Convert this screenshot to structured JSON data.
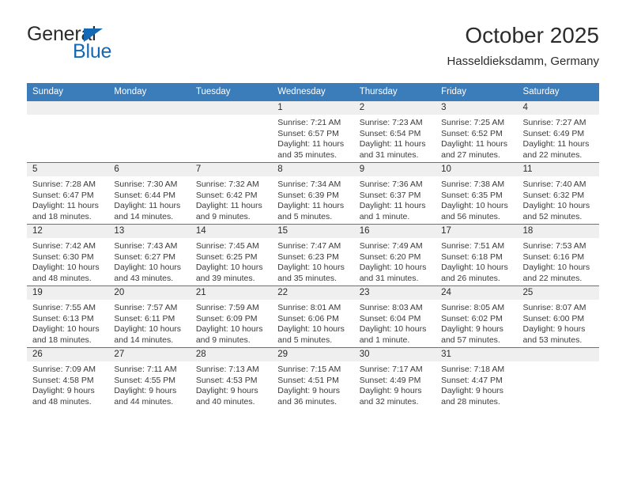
{
  "brand": {
    "name_part1": "General",
    "name_part2": "Blue",
    "colors": {
      "blue": "#1569b4",
      "dark": "#2b2b2b"
    },
    "triangle_icon": "triangle-icon"
  },
  "header": {
    "title": "October 2025",
    "subtitle": "Hasseldieksdamm, Germany"
  },
  "calendar": {
    "header_bg": "#3b7cba",
    "daynum_bg": "#efefef",
    "weekday_headers": [
      "Sunday",
      "Monday",
      "Tuesday",
      "Wednesday",
      "Thursday",
      "Friday",
      "Saturday"
    ],
    "weeks": [
      [
        {
          "day": "",
          "sunrise": "",
          "sunset": "",
          "daylight": ""
        },
        {
          "day": "",
          "sunrise": "",
          "sunset": "",
          "daylight": ""
        },
        {
          "day": "",
          "sunrise": "",
          "sunset": "",
          "daylight": ""
        },
        {
          "day": "1",
          "sunrise": "Sunrise: 7:21 AM",
          "sunset": "Sunset: 6:57 PM",
          "daylight": "Daylight: 11 hours and 35 minutes."
        },
        {
          "day": "2",
          "sunrise": "Sunrise: 7:23 AM",
          "sunset": "Sunset: 6:54 PM",
          "daylight": "Daylight: 11 hours and 31 minutes."
        },
        {
          "day": "3",
          "sunrise": "Sunrise: 7:25 AM",
          "sunset": "Sunset: 6:52 PM",
          "daylight": "Daylight: 11 hours and 27 minutes."
        },
        {
          "day": "4",
          "sunrise": "Sunrise: 7:27 AM",
          "sunset": "Sunset: 6:49 PM",
          "daylight": "Daylight: 11 hours and 22 minutes."
        }
      ],
      [
        {
          "day": "5",
          "sunrise": "Sunrise: 7:28 AM",
          "sunset": "Sunset: 6:47 PM",
          "daylight": "Daylight: 11 hours and 18 minutes."
        },
        {
          "day": "6",
          "sunrise": "Sunrise: 7:30 AM",
          "sunset": "Sunset: 6:44 PM",
          "daylight": "Daylight: 11 hours and 14 minutes."
        },
        {
          "day": "7",
          "sunrise": "Sunrise: 7:32 AM",
          "sunset": "Sunset: 6:42 PM",
          "daylight": "Daylight: 11 hours and 9 minutes."
        },
        {
          "day": "8",
          "sunrise": "Sunrise: 7:34 AM",
          "sunset": "Sunset: 6:39 PM",
          "daylight": "Daylight: 11 hours and 5 minutes."
        },
        {
          "day": "9",
          "sunrise": "Sunrise: 7:36 AM",
          "sunset": "Sunset: 6:37 PM",
          "daylight": "Daylight: 11 hours and 1 minute."
        },
        {
          "day": "10",
          "sunrise": "Sunrise: 7:38 AM",
          "sunset": "Sunset: 6:35 PM",
          "daylight": "Daylight: 10 hours and 56 minutes."
        },
        {
          "day": "11",
          "sunrise": "Sunrise: 7:40 AM",
          "sunset": "Sunset: 6:32 PM",
          "daylight": "Daylight: 10 hours and 52 minutes."
        }
      ],
      [
        {
          "day": "12",
          "sunrise": "Sunrise: 7:42 AM",
          "sunset": "Sunset: 6:30 PM",
          "daylight": "Daylight: 10 hours and 48 minutes."
        },
        {
          "day": "13",
          "sunrise": "Sunrise: 7:43 AM",
          "sunset": "Sunset: 6:27 PM",
          "daylight": "Daylight: 10 hours and 43 minutes."
        },
        {
          "day": "14",
          "sunrise": "Sunrise: 7:45 AM",
          "sunset": "Sunset: 6:25 PM",
          "daylight": "Daylight: 10 hours and 39 minutes."
        },
        {
          "day": "15",
          "sunrise": "Sunrise: 7:47 AM",
          "sunset": "Sunset: 6:23 PM",
          "daylight": "Daylight: 10 hours and 35 minutes."
        },
        {
          "day": "16",
          "sunrise": "Sunrise: 7:49 AM",
          "sunset": "Sunset: 6:20 PM",
          "daylight": "Daylight: 10 hours and 31 minutes."
        },
        {
          "day": "17",
          "sunrise": "Sunrise: 7:51 AM",
          "sunset": "Sunset: 6:18 PM",
          "daylight": "Daylight: 10 hours and 26 minutes."
        },
        {
          "day": "18",
          "sunrise": "Sunrise: 7:53 AM",
          "sunset": "Sunset: 6:16 PM",
          "daylight": "Daylight: 10 hours and 22 minutes."
        }
      ],
      [
        {
          "day": "19",
          "sunrise": "Sunrise: 7:55 AM",
          "sunset": "Sunset: 6:13 PM",
          "daylight": "Daylight: 10 hours and 18 minutes."
        },
        {
          "day": "20",
          "sunrise": "Sunrise: 7:57 AM",
          "sunset": "Sunset: 6:11 PM",
          "daylight": "Daylight: 10 hours and 14 minutes."
        },
        {
          "day": "21",
          "sunrise": "Sunrise: 7:59 AM",
          "sunset": "Sunset: 6:09 PM",
          "daylight": "Daylight: 10 hours and 9 minutes."
        },
        {
          "day": "22",
          "sunrise": "Sunrise: 8:01 AM",
          "sunset": "Sunset: 6:06 PM",
          "daylight": "Daylight: 10 hours and 5 minutes."
        },
        {
          "day": "23",
          "sunrise": "Sunrise: 8:03 AM",
          "sunset": "Sunset: 6:04 PM",
          "daylight": "Daylight: 10 hours and 1 minute."
        },
        {
          "day": "24",
          "sunrise": "Sunrise: 8:05 AM",
          "sunset": "Sunset: 6:02 PM",
          "daylight": "Daylight: 9 hours and 57 minutes."
        },
        {
          "day": "25",
          "sunrise": "Sunrise: 8:07 AM",
          "sunset": "Sunset: 6:00 PM",
          "daylight": "Daylight: 9 hours and 53 minutes."
        }
      ],
      [
        {
          "day": "26",
          "sunrise": "Sunrise: 7:09 AM",
          "sunset": "Sunset: 4:58 PM",
          "daylight": "Daylight: 9 hours and 48 minutes."
        },
        {
          "day": "27",
          "sunrise": "Sunrise: 7:11 AM",
          "sunset": "Sunset: 4:55 PM",
          "daylight": "Daylight: 9 hours and 44 minutes."
        },
        {
          "day": "28",
          "sunrise": "Sunrise: 7:13 AM",
          "sunset": "Sunset: 4:53 PM",
          "daylight": "Daylight: 9 hours and 40 minutes."
        },
        {
          "day": "29",
          "sunrise": "Sunrise: 7:15 AM",
          "sunset": "Sunset: 4:51 PM",
          "daylight": "Daylight: 9 hours and 36 minutes."
        },
        {
          "day": "30",
          "sunrise": "Sunrise: 7:17 AM",
          "sunset": "Sunset: 4:49 PM",
          "daylight": "Daylight: 9 hours and 32 minutes."
        },
        {
          "day": "31",
          "sunrise": "Sunrise: 7:18 AM",
          "sunset": "Sunset: 4:47 PM",
          "daylight": "Daylight: 9 hours and 28 minutes."
        },
        {
          "day": "",
          "sunrise": "",
          "sunset": "",
          "daylight": ""
        }
      ]
    ]
  }
}
